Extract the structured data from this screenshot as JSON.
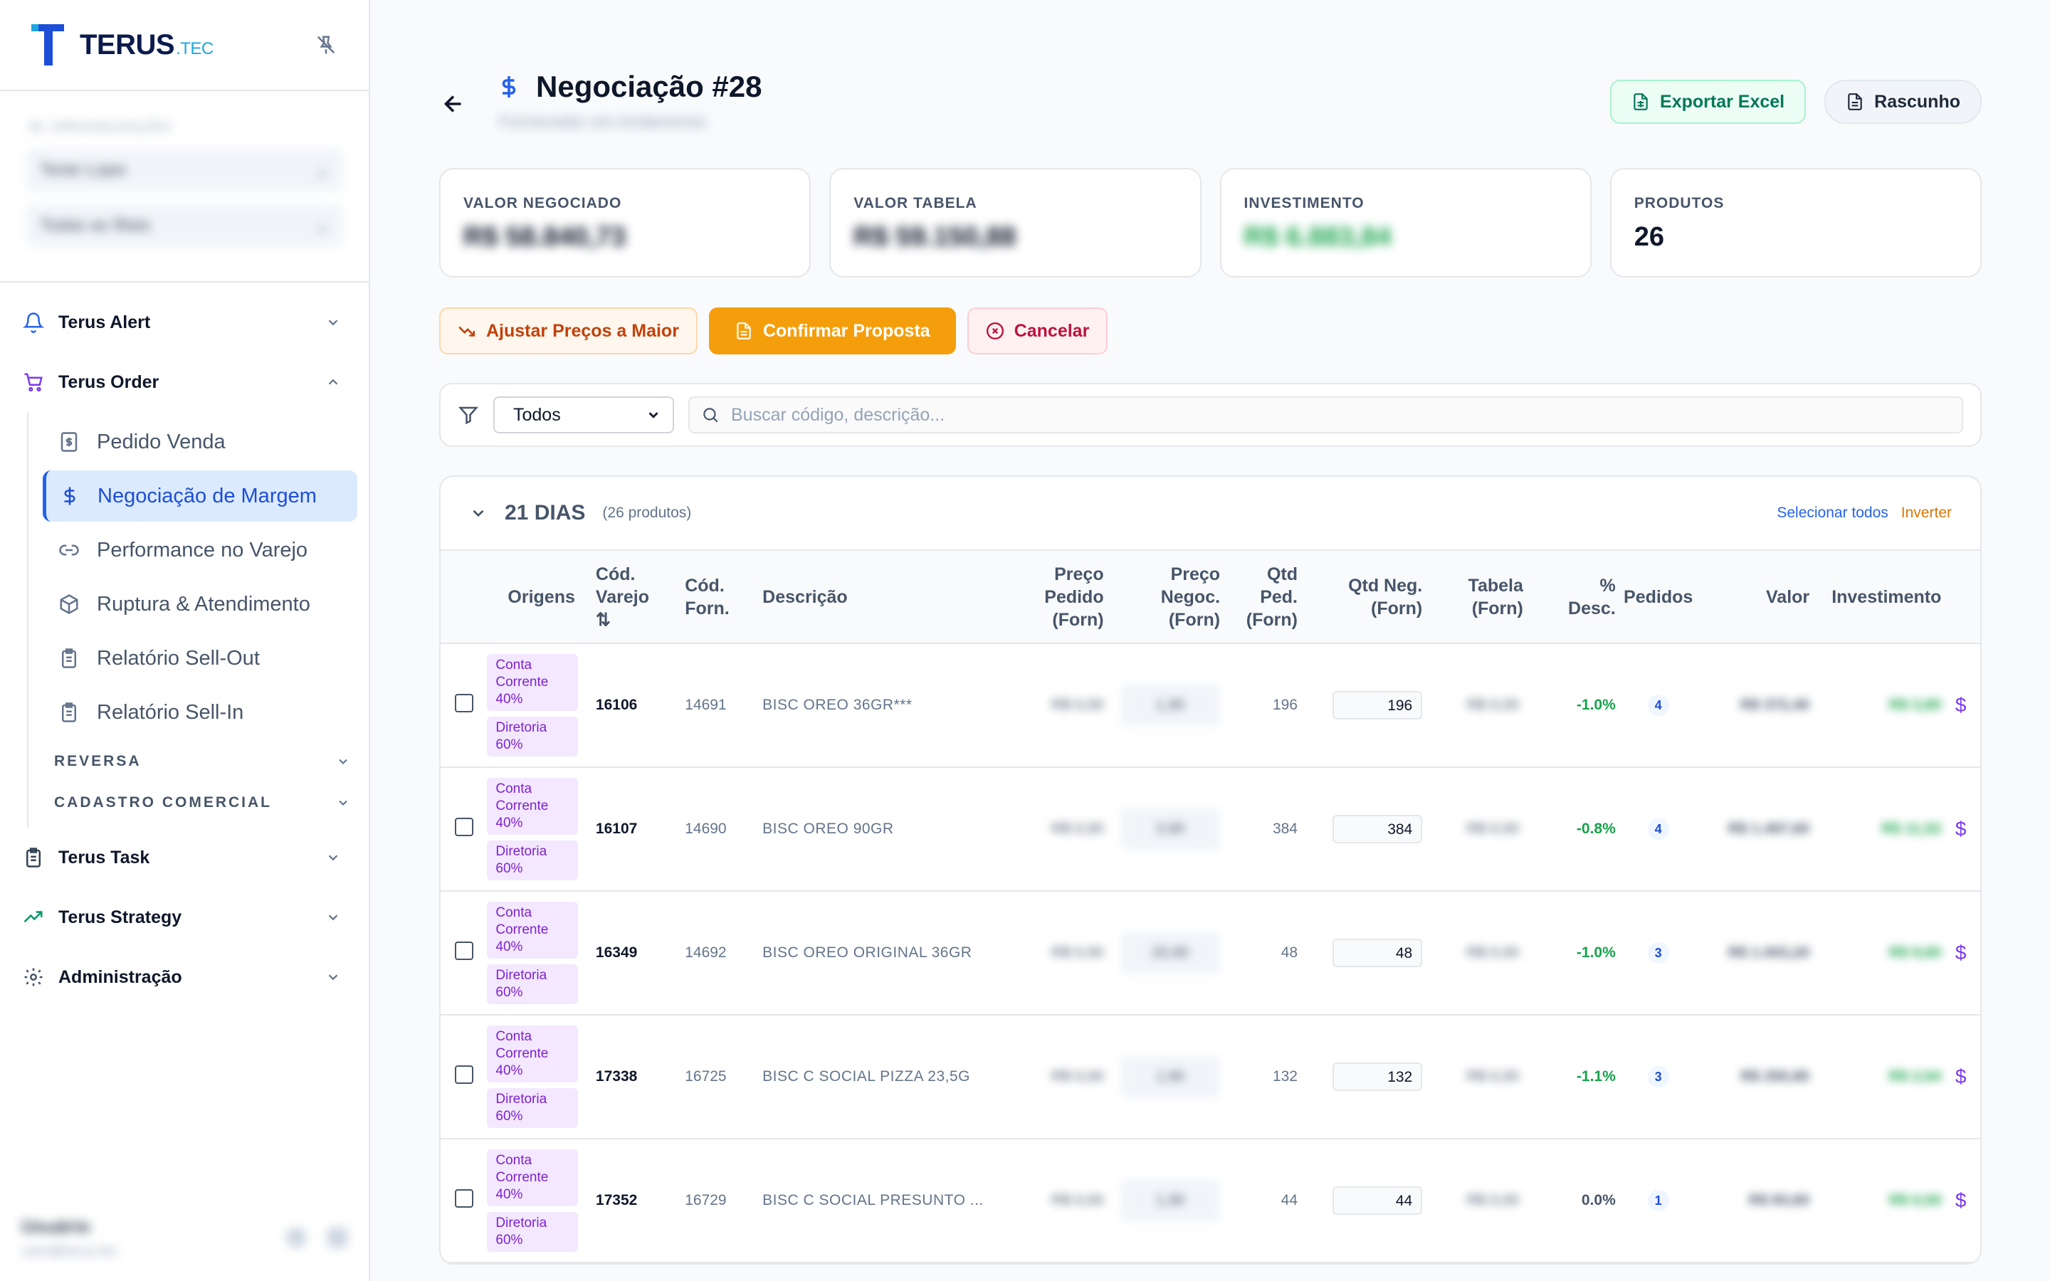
{
  "brand": {
    "name": "TERUS",
    "suffix": ".TEC"
  },
  "org": {
    "label": "ID ORGANIZAÇÃO",
    "select1": "Teste Lojas",
    "select2": "Todas as filiais"
  },
  "nav": {
    "alert": "Terus Alert",
    "order": "Terus Order",
    "order_items": [
      "Pedido Venda",
      "Negociação de Margem",
      "Performance no Varejo",
      "Ruptura & Atendimento",
      "Relatório Sell-Out",
      "Relatório Sell-In"
    ],
    "reversa": "REVERSA",
    "cadastro": "CADASTRO COMERCIAL",
    "task": "Terus Task",
    "strategy": "Terus Strategy",
    "admin": "Administração"
  },
  "user": {
    "name": "Usuário",
    "email": "user@terus.tec"
  },
  "page": {
    "title": "Negociação #28",
    "subtitle": "Fornecedor em Andamento",
    "export": "Exportar Excel",
    "draft": "Rascunho"
  },
  "cards": [
    {
      "label": "VALOR NEGOCIADO",
      "value": "R$ 58.840,73"
    },
    {
      "label": "VALOR TABELA",
      "value": "R$ 59.150,88"
    },
    {
      "label": "INVESTIMENTO",
      "value": "R$ 6.883,84"
    },
    {
      "label": "PRODUTOS",
      "value": "26"
    }
  ],
  "actions": {
    "adjust": "Ajustar Preços a Maior",
    "confirm": "Confirmar Proposta",
    "cancel": "Cancelar"
  },
  "filter": {
    "select": "Todos",
    "search_placeholder": "Buscar código, descrição..."
  },
  "group": {
    "title": "21 DIAS",
    "count": "(26 produtos)",
    "select_all": "Selecionar todos",
    "invert": "Inverter"
  },
  "columns": {
    "origens": "Origens",
    "cod_varejo": "Cód. Varejo",
    "sort": "⇅",
    "cod_forn": "Cód. Forn.",
    "descricao": "Descrição",
    "preco_pedido": "Preço Pedido (Forn)",
    "preco_negoc": "Preço Negoc. (Forn)",
    "qtd_ped": "Qtd Ped. (Forn)",
    "qtd_neg": "Qtd Neg. (Forn)",
    "tabela": "Tabela (Forn)",
    "desc": "% Desc.",
    "pedidos": "Pedidos",
    "valor": "Valor",
    "investimento": "Investimento"
  },
  "rows": [
    {
      "tag1": "Conta Corrente 40%",
      "tag2": "Diretoria 60%",
      "cod_varejo": "16106",
      "cod_forn": "14691",
      "descricao": "BISC OREO 36GR***",
      "preco_pedido": "R$ 0,00",
      "preco_negoc": "1,90",
      "qtd_ped": "196",
      "qtd_neg": "196",
      "tabela": "R$ 0,00",
      "desc": "-1.0%",
      "pedidos": "4",
      "valor": "R$ 372,40",
      "investimento": "R$ 3,80"
    },
    {
      "tag1": "Conta Corrente 40%",
      "tag2": "Diretoria 60%",
      "cod_varejo": "16107",
      "cod_forn": "14690",
      "descricao": "BISC OREO 90GR",
      "preco_pedido": "R$ 0,00",
      "preco_negoc": "3,90",
      "qtd_ped": "384",
      "qtd_neg": "384",
      "tabela": "R$ 0,00",
      "desc": "-0.8%",
      "pedidos": "4",
      "valor": "R$ 1.497,60",
      "investimento": "R$ 11,52"
    },
    {
      "tag1": "Conta Corrente 40%",
      "tag2": "Diretoria 60%",
      "cod_varejo": "16349",
      "cod_forn": "14692",
      "descricao": "BISC OREO ORIGINAL 36GR",
      "preco_pedido": "R$ 0,00",
      "preco_negoc": "20,90",
      "qtd_ped": "48",
      "qtd_neg": "48",
      "tabela": "R$ 0,00",
      "desc": "-1.0%",
      "pedidos": "3",
      "valor": "R$ 1.003,20",
      "investimento": "R$ 9,60"
    },
    {
      "tag1": "Conta Corrente 40%",
      "tag2": "Diretoria 60%",
      "cod_varejo": "17338",
      "cod_forn": "16725",
      "descricao": "BISC C SOCIAL PIZZA 23,5G",
      "preco_pedido": "R$ 0,00",
      "preco_negoc": "1,90",
      "qtd_ped": "132",
      "qtd_neg": "132",
      "tabela": "R$ 0,00",
      "desc": "-1.1%",
      "pedidos": "3",
      "valor": "R$ 250,80",
      "investimento": "R$ 2,64"
    },
    {
      "tag1": "Conta Corrente 40%",
      "tag2": "Diretoria 60%",
      "cod_varejo": "17352",
      "cod_forn": "16729",
      "descricao": "BISC C SOCIAL PRESUNTO ...",
      "preco_pedido": "R$ 0,00",
      "preco_negoc": "1,90",
      "qtd_ped": "44",
      "qtd_neg": "44",
      "tabela": "R$ 0,00",
      "desc": "0.0%",
      "pedidos": "1",
      "valor": "R$ 83,60",
      "investimento": "R$ 0,00"
    }
  ],
  "colors": {
    "accent": "#2563eb",
    "orange": "#f59e0b",
    "green": "#16a34a",
    "purple": "#7c3aed"
  }
}
